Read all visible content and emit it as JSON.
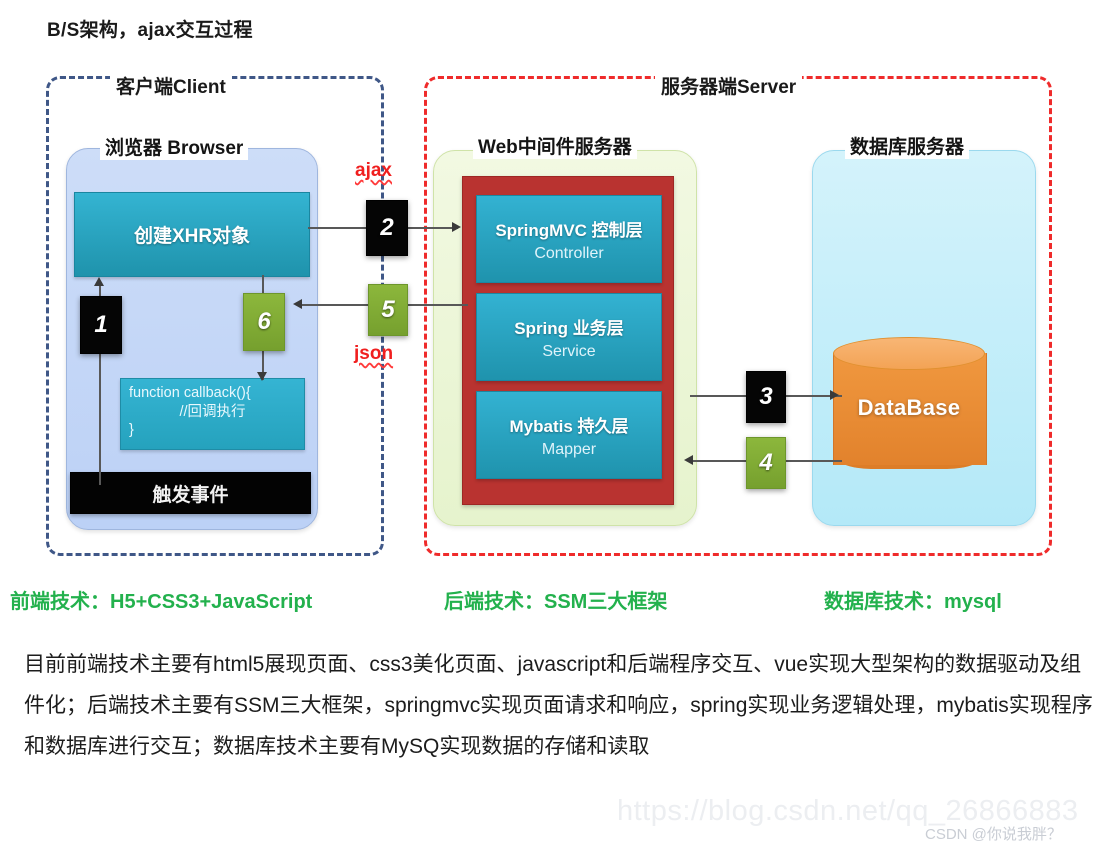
{
  "title": "B/S架构，ajax交互过程",
  "zones": {
    "client": {
      "label": "客户端Client",
      "border_color": "#3f5787"
    },
    "server": {
      "label": "服务器端Server",
      "border_color": "#ef2b2b"
    }
  },
  "client": {
    "browser_panel_label": "浏览器 Browser",
    "xhr_box": "创建XHR对象",
    "callback_box": {
      "line1": "function callback(){",
      "line2": "//回调执行",
      "line3": "}"
    },
    "trigger_event_box": "触发事件"
  },
  "server": {
    "middleware_panel_label": "Web中间件服务器",
    "ssm_layers": [
      {
        "title": "SpringMVC 控制层",
        "subtitle": "Controller"
      },
      {
        "title": "Spring 业务层",
        "subtitle": "Service"
      },
      {
        "title": "Mybatis 持久层",
        "subtitle": "Mapper"
      }
    ],
    "db_panel_label": "数据库服务器",
    "db_cylinder_label": "DataBase"
  },
  "steps": [
    {
      "n": "1",
      "style": "black"
    },
    {
      "n": "2",
      "style": "black"
    },
    {
      "n": "3",
      "style": "black"
    },
    {
      "n": "4",
      "style": "green"
    },
    {
      "n": "5",
      "style": "green"
    },
    {
      "n": "6",
      "style": "green"
    }
  ],
  "protocol_labels": {
    "request": "ajax",
    "response": "json"
  },
  "tech_labels": [
    "前端技术：H5+CSS3+JavaScript",
    "后端技术：SSM三大框架",
    "数据库技术：mysql"
  ],
  "summary_paragraph": "目前前端技术主要有html5展现页面、css3美化页面、javascript和后端程序交互、vue实现大型架构的数据驱动及组件化；后端技术主要有SSM三大框架，springmvc实现页面请求和响应，spring实现业务逻辑处理，mybatis实现程序和数据库进行交互；数据库技术主要有MySQ实现数据的存储和读取",
  "watermark": {
    "url": "https://blog.csdn.net/qq_26866883",
    "author": "CSDN @你说我胖？"
  },
  "colors": {
    "client_border": "#3f5787",
    "server_border": "#ef2b2b",
    "teal": "#2aa8c6",
    "crimson": "#b93330",
    "orange": "#ea8a32",
    "green_badge": "#84b136",
    "tech_green": "#23b14d",
    "proto_red": "#f01f1f"
  }
}
